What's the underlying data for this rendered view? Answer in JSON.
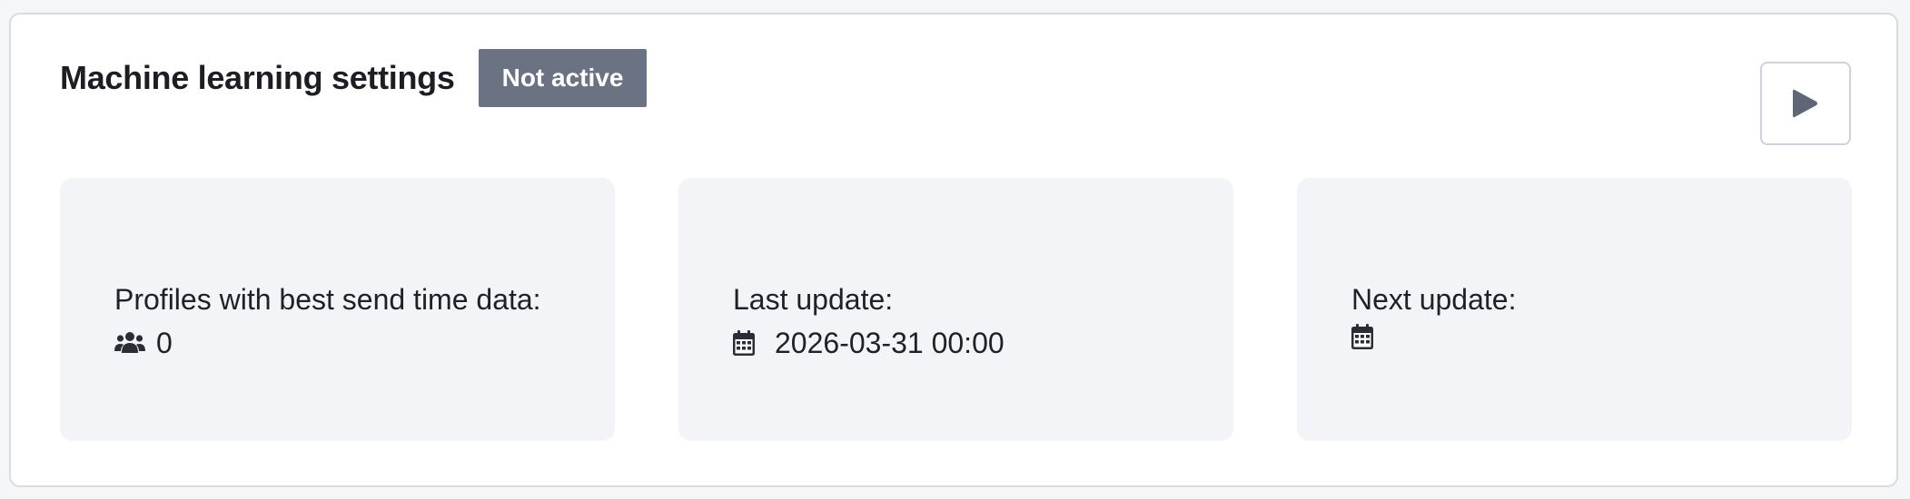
{
  "header": {
    "title": "Machine learning settings",
    "status_badge": "Not active"
  },
  "actions": {
    "play_icon": "play-icon"
  },
  "tiles": [
    {
      "label": "Profiles with best send time data:",
      "icon": "users-icon",
      "value": "0"
    },
    {
      "label": "Last update:",
      "icon": "calendar-icon",
      "value": "2026-03-31 00:00"
    },
    {
      "label": "Next update:",
      "icon": "calendar-icon",
      "value": ""
    }
  ],
  "colors": {
    "badge_bg": "#6b7282",
    "tile_bg": "#f3f4f7",
    "icon": "#5f6675"
  }
}
